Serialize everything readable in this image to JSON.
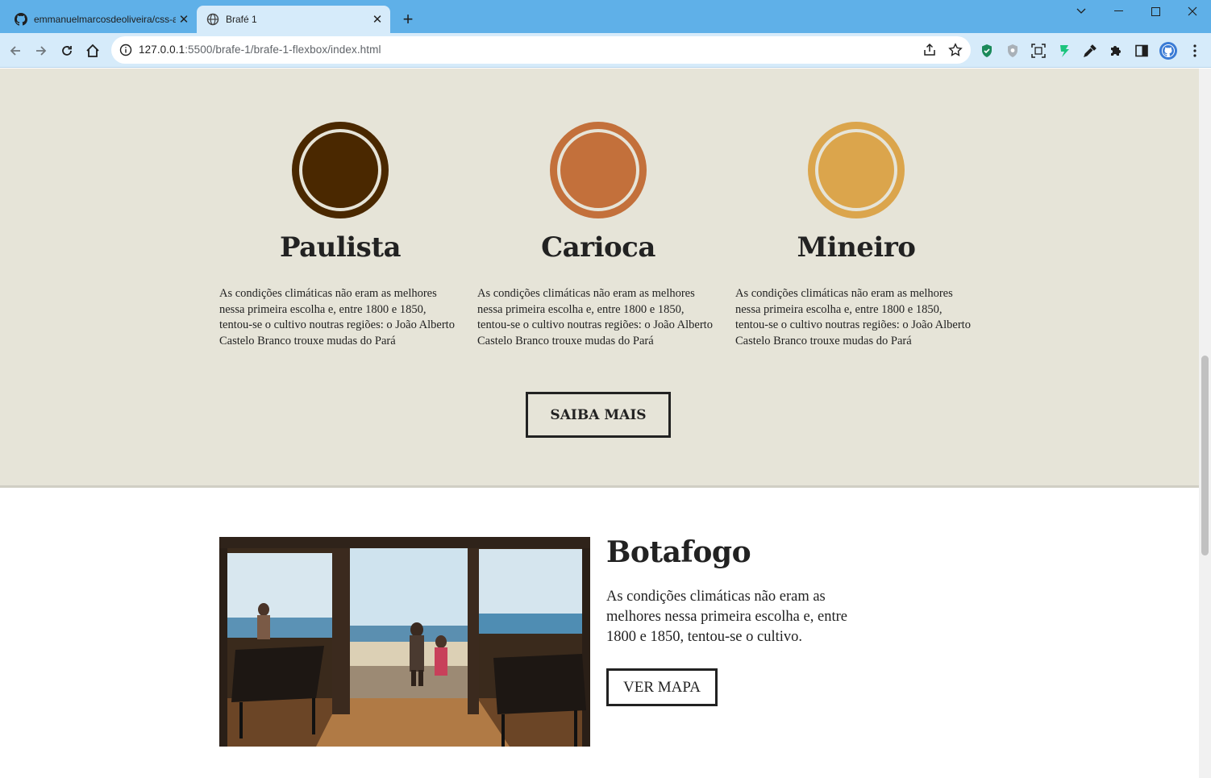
{
  "browser": {
    "tabs": [
      {
        "title": "emmanuelmarcosdeoliveira/css-a",
        "icon": "github-icon",
        "active": false
      },
      {
        "title": "Brafé 1",
        "icon": "globe-icon",
        "active": true
      }
    ],
    "url_host": "127.0.0.1",
    "url_rest": ":5500/brafe-1/brafe-1-flexbox/index.html"
  },
  "features": [
    {
      "name": "Paulista",
      "color": "#4a2800",
      "text": "As condições climáticas não eram as melhores nessa primeira escolha e, entre 1800 e 1850, tentou-se o cultivo noutras regiões: o João Alberto Castelo Branco trouxe mudas do Pará"
    },
    {
      "name": "Carioca",
      "color": "#c3703b",
      "text": "As condições climáticas não eram as melhores nessa primeira escolha e, entre 1800 e 1850, tentou-se o cultivo noutras regiões: o João Alberto Castelo Branco trouxe mudas do Pará"
    },
    {
      "name": "Mineiro",
      "color": "#dba54c",
      "text": "As condições climáticas não eram as melhores nessa primeira escolha e, entre 1800 e 1850, tentou-se o cultivo noutras regiões: o João Alberto Castelo Branco trouxe mudas do Pará"
    }
  ],
  "saiba_mais": "SAIBA MAIS",
  "place": {
    "title": "Botafogo",
    "description": "As condições climáticas não eram as melhores nessa primeira escolha e, entre 1800 e 1850, tentou-se o cultivo.",
    "button": "VER MAPA"
  }
}
